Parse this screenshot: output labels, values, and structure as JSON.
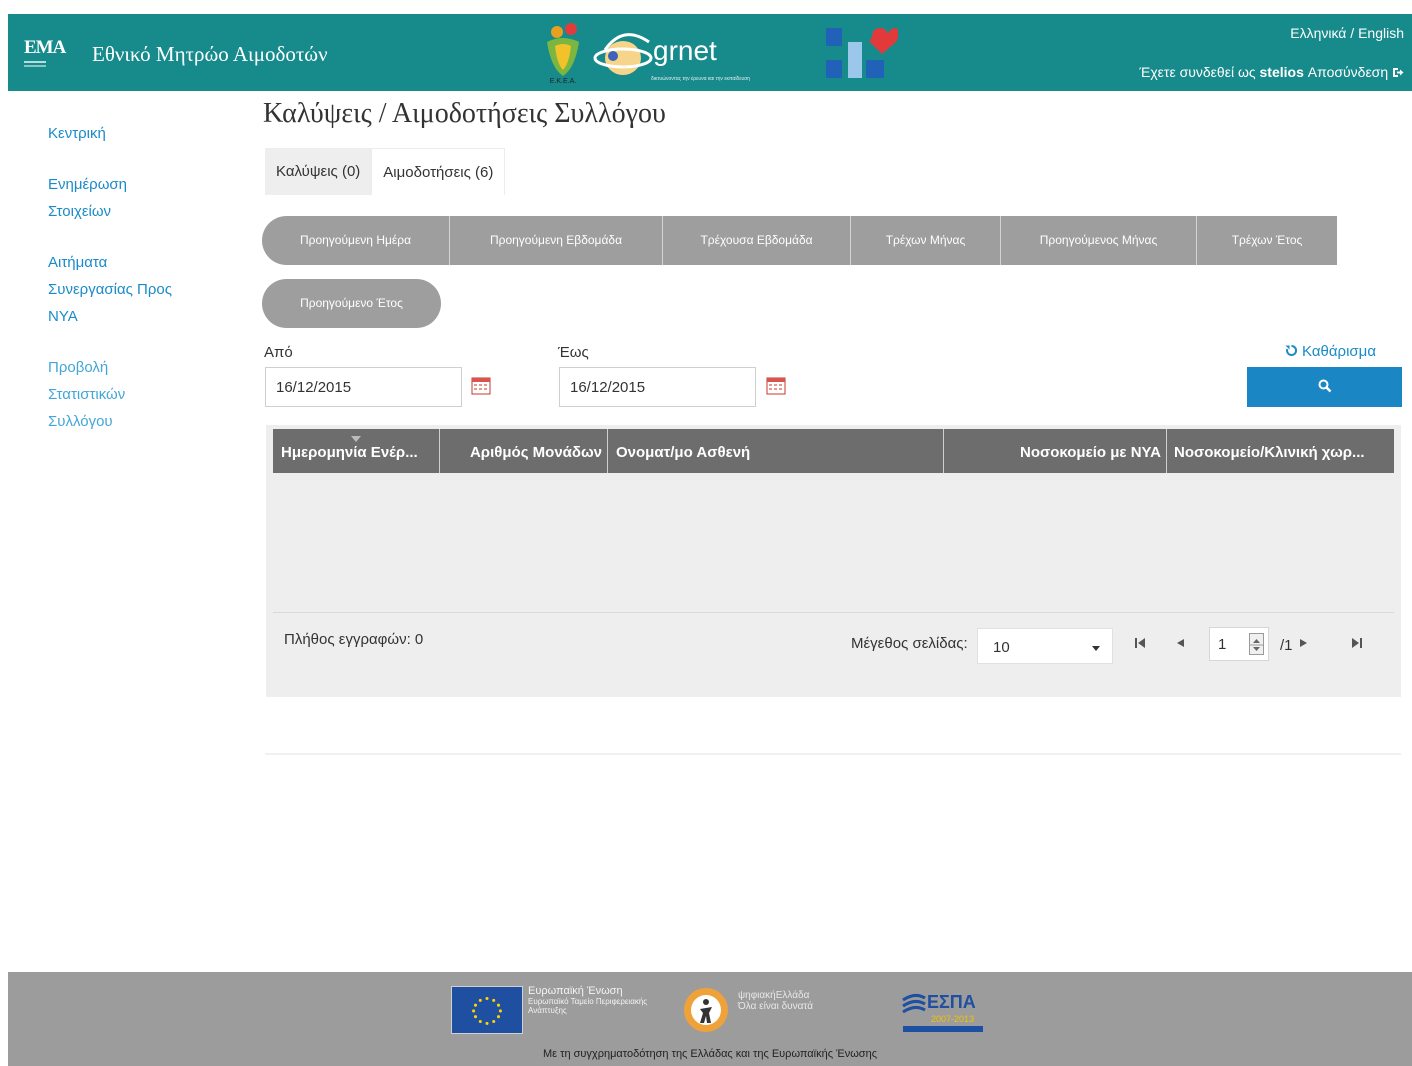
{
  "header": {
    "logo_text": "ΕΜΑ",
    "site_title": "Εθνικό Μητρώο Αιμοδοτών",
    "partner_ekea_label": "Ε.Κ.Ε.Α.",
    "partner_grnet_label": "grnet",
    "partner_grnet_sub": "δικτυώνοντας την έρευνα και την εκπαίδευση",
    "lang_greek": "Ελληνικά",
    "lang_sep": " / ",
    "lang_english": "English",
    "logged_in_prefix": "Έχετε συνδεθεί ως ",
    "username": "stelios",
    "logout_label": "Αποσύνδεση"
  },
  "sidebar": {
    "items": [
      {
        "label": "Κεντρική"
      },
      {
        "label": "Ενημέρωση Στοιχείων"
      },
      {
        "label": "Αιτήματα Συνεργασίας Προς ΝΥΑ"
      },
      {
        "label": "Προβολή Στατιστικών Συλλόγου"
      }
    ]
  },
  "page": {
    "title": "Καλύψεις / Αιμοδοτήσεις Συλλόγου"
  },
  "tabs": [
    {
      "label": "Καλύψεις (0)",
      "active": false
    },
    {
      "label": "Αιμοδοτήσεις (6)",
      "active": true
    }
  ],
  "periods": [
    "Προηγούμενη Ημέρα",
    "Προηγούμενη Εβδομάδα",
    "Τρέχουσα Εβδομάδα",
    "Τρέχων Μήνας",
    "Προηγούμενος Μήνας",
    "Τρέχων Έτος",
    "Προηγούμενο Έτος"
  ],
  "filters": {
    "from_label": "Από",
    "from_value": "16/12/2015",
    "to_label": "Έως",
    "to_value": "16/12/2015",
    "clear_label": "Καθάρισμα"
  },
  "grid": {
    "columns": [
      "Ημερομηνία Ενέρ...",
      "Αριθμός Μονάδων",
      "Ονοματ/μο Ασθενή",
      "Νοσοκομείο με ΝΥΑ",
      "Νοσοκομείο/Κλινική χωρ..."
    ],
    "records_label": "Πλήθος εγγραφών: 0",
    "page_size_label": "Μέγεθος σελίδας:",
    "page_size_value": "10",
    "current_page": "1",
    "total_pages": "/1"
  },
  "footer": {
    "eu_title": "Ευρωπαϊκή Ένωση",
    "eu_sub": "Ευρωπαϊκό Ταμείο Περιφερειακής Ανάπτυξης",
    "dg_title": "ψηφιακήΕλλάδα",
    "dg_sub": "Όλα είναι δυνατά",
    "espa_label": "ΕΣΠΑ",
    "espa_years": "2007-2013",
    "caption": "Με τη συγχρηματοδότηση της Ελλάδας και της Ευρωπαϊκής Ένωσης"
  },
  "colors": {
    "header_bg": "#178a8c",
    "link": "#1a8bc9",
    "primary_button": "#1a87c4",
    "period_button": "#9e9e9e",
    "grid_header": "#6d6d6d"
  }
}
